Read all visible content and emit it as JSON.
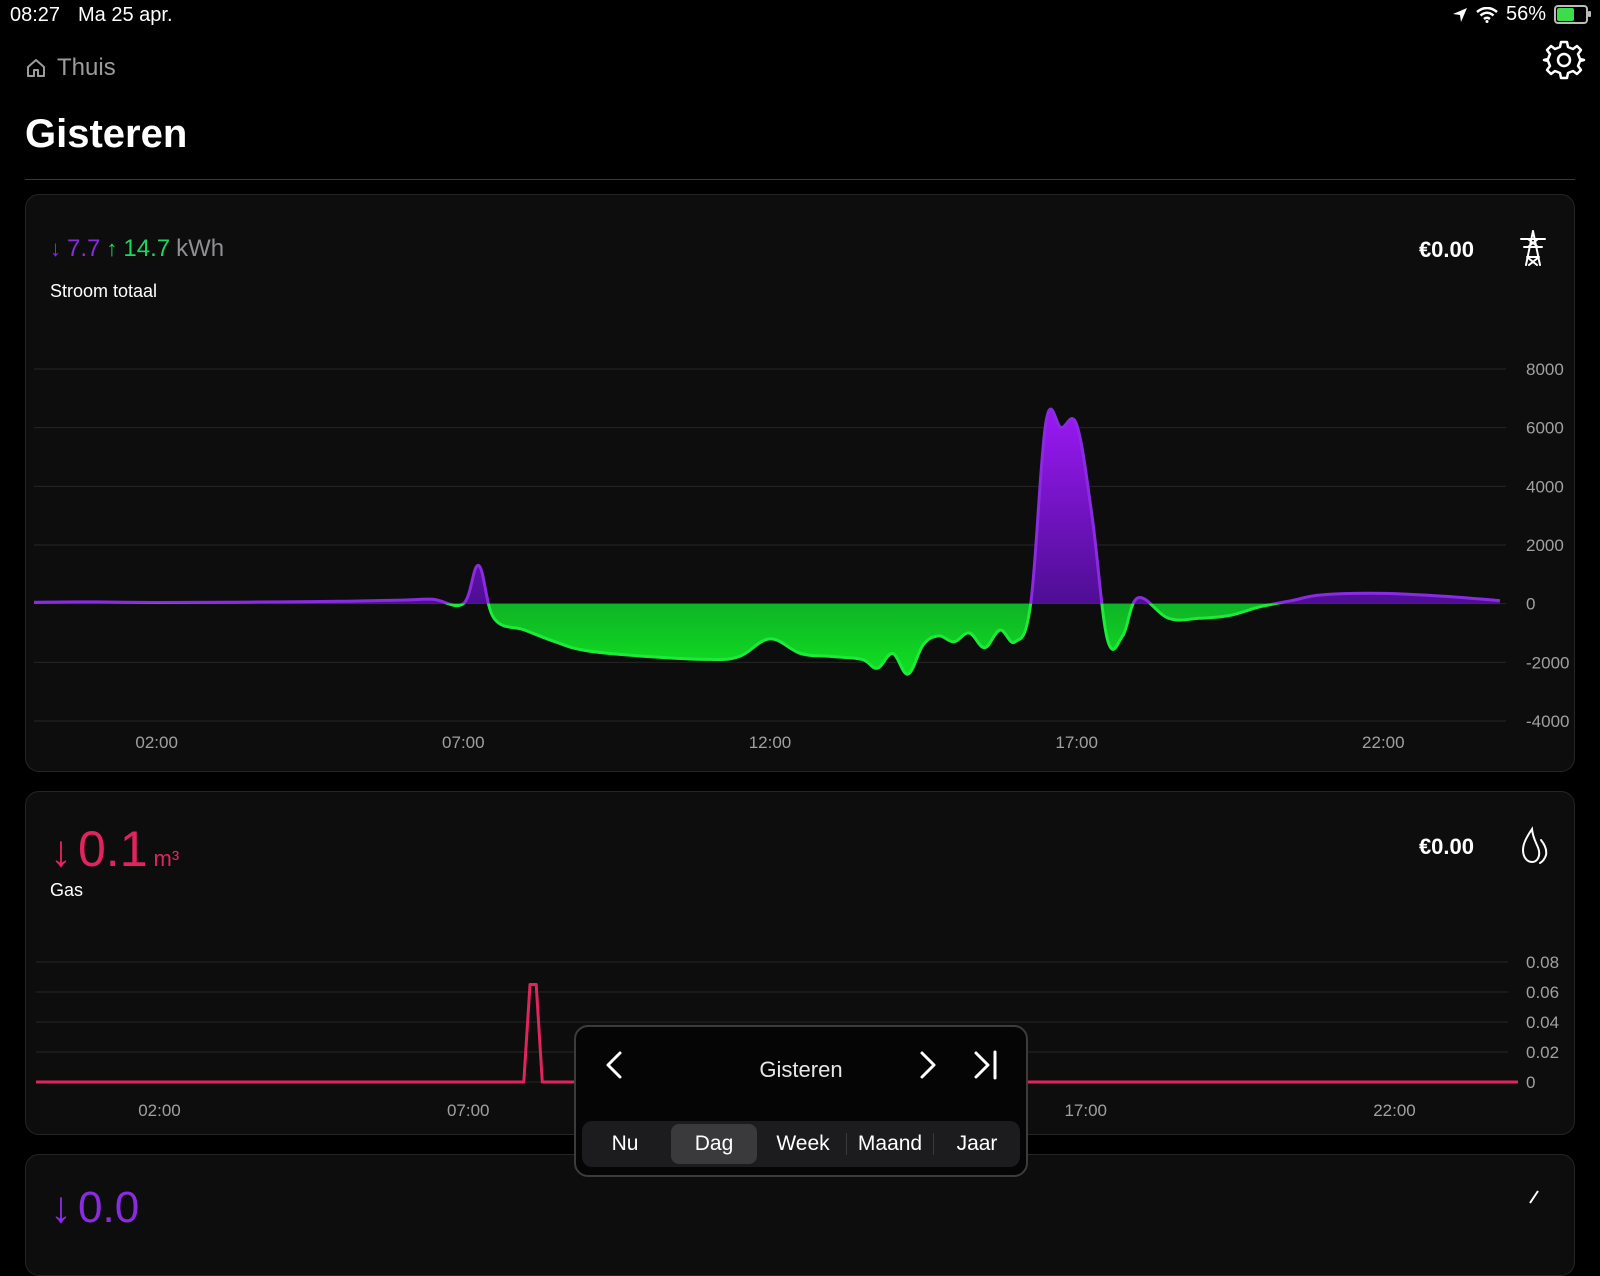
{
  "status": {
    "time": "08:27",
    "date": "Ma 25 apr.",
    "battery": "56%"
  },
  "header": {
    "breadcrumb": "Thuis",
    "title": "Gisteren"
  },
  "power_card": {
    "import_value": "7.7",
    "export_value": "14.7",
    "unit": "kWh",
    "label": "Stroom totaal",
    "cost": "€0.00"
  },
  "gas_card": {
    "value": "0.1",
    "unit": "m³",
    "label": "Gas",
    "cost": "€0.00"
  },
  "third_card": {
    "value": "0.0"
  },
  "picker": {
    "label": "Gisteren",
    "options": [
      "Nu",
      "Dag",
      "Week",
      "Maand",
      "Jaar"
    ],
    "selected": "Dag"
  },
  "colors": {
    "import": "#8a2be2",
    "export": "#1ed760",
    "gas": "#e0245e",
    "kwh_unit": "#8e8e93"
  },
  "chart_data": [
    {
      "type": "area",
      "title": "Stroom totaal",
      "x_ticks": [
        "02:00",
        "07:00",
        "12:00",
        "17:00",
        "22:00"
      ],
      "y_ticks": [
        8000,
        6000,
        4000,
        2000,
        0,
        -2000,
        -4000
      ],
      "ylim": [
        -4000,
        8000
      ],
      "series": [
        {
          "x": [
            0,
            1,
            2,
            3,
            4,
            5,
            6,
            6.5,
            7,
            7.25,
            7.5,
            8,
            8.5,
            9,
            10,
            11,
            11.5,
            12,
            12.5,
            13,
            13.5,
            13.75,
            14,
            14.25,
            14.5,
            14.75,
            15,
            15.25,
            15.5,
            15.75,
            16,
            16.25,
            16.5,
            16.75,
            17,
            17.25,
            17.5,
            17.75,
            18,
            18.5,
            19,
            19.5,
            20,
            20.5,
            21,
            22,
            23,
            23.9
          ],
          "y": [
            50,
            60,
            40,
            50,
            60,
            80,
            120,
            150,
            0,
            1300,
            -500,
            -900,
            -1300,
            -1600,
            -1800,
            -1900,
            -1800,
            -1200,
            -1700,
            -1800,
            -1900,
            -2200,
            -1700,
            -2400,
            -1400,
            -1100,
            -1300,
            -1000,
            -1500,
            -900,
            -1300,
            0,
            6200,
            6000,
            6100,
            3000,
            -1200,
            -1100,
            200,
            -500,
            -500,
            -400,
            -100,
            100,
            300,
            350,
            250,
            100
          ]
        }
      ]
    },
    {
      "type": "line",
      "title": "Gas",
      "x_ticks": [
        "02:00",
        "07:00",
        "12:00",
        "17:00",
        "22:00"
      ],
      "y_ticks": [
        0.08,
        0.06,
        0.04,
        0.02,
        0
      ],
      "ylim": [
        0,
        0.08
      ],
      "series": [
        {
          "x": [
            0,
            7.9,
            8.0,
            8.1,
            8.2,
            24
          ],
          "y": [
            0,
            0,
            0.065,
            0.065,
            0,
            0
          ]
        }
      ]
    }
  ]
}
